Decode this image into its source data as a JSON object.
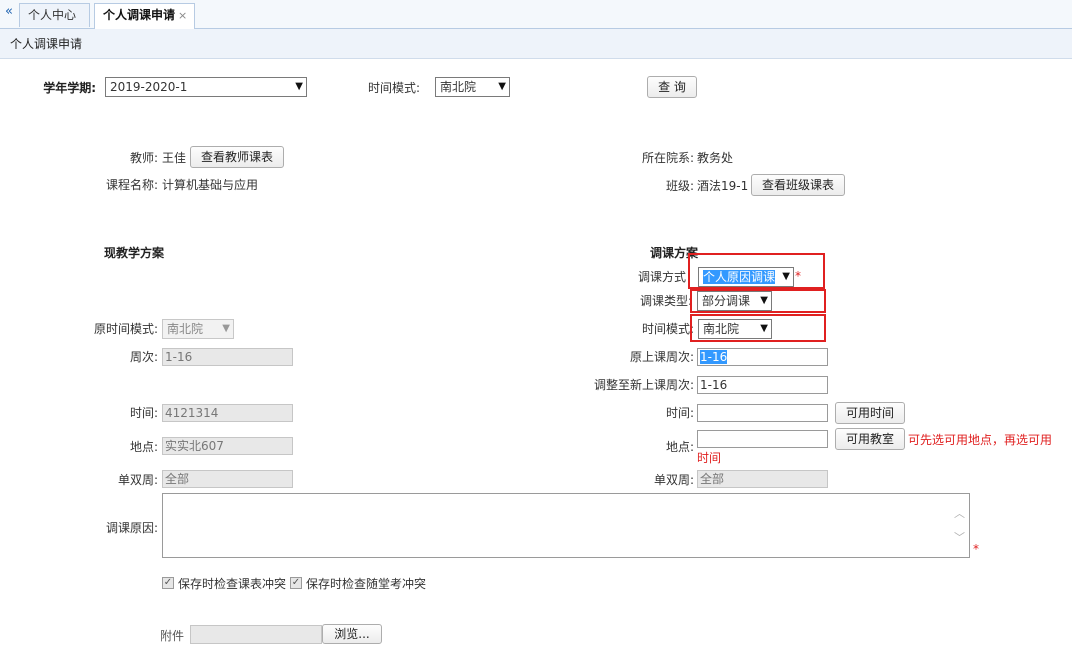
{
  "tabs": {
    "collapse_glyph": "«",
    "home": "个人中心",
    "active": "个人调课申请",
    "close_glyph": "×"
  },
  "page_title": "个人调课申请",
  "filter": {
    "term_label": "学年学期:",
    "term_value": "2019-2020-1",
    "time_mode_label": "时间模式:",
    "time_mode_value": "南北院",
    "query_button": "查 询"
  },
  "info": {
    "teacher_label": "教师:",
    "teacher_name": "王佳",
    "view_teacher_schedule": "查看教师课表",
    "course_label": "课程名称:",
    "course_name": "计算机基础与应用",
    "dept_label": "所在院系:",
    "dept_value": "教务处",
    "class_label": "班级:",
    "class_value": "酒法19-1",
    "view_class_schedule": "查看班级课表"
  },
  "current_plan": {
    "title": "现教学方案",
    "time_mode_label": "原时间模式:",
    "time_mode_value": "南北院",
    "weeks_label": "周次:",
    "weeks_value": "1-16",
    "time_label": "时间:",
    "time_value": "4121314",
    "place_label": "地点:",
    "place_value": "实实北607",
    "odd_even_label": "单双周:",
    "odd_even_value": "全部"
  },
  "adjust_plan": {
    "title": "调课方案",
    "method_label": "调课方式",
    "method_value": "个人原因调课",
    "required_mark": "*",
    "type_label": "调课类型:",
    "type_value": "部分调课",
    "time_mode_label": "时间模式:",
    "time_mode_value": "南北院",
    "orig_weeks_label": "原上课周次:",
    "orig_weeks_sel": "1",
    "orig_weeks_rest": "-16",
    "new_weeks_label": "调整至新上课周次:",
    "new_weeks_value": "1-16",
    "time_label": "时间:",
    "time_value": "",
    "avail_time_button": "可用时间",
    "place_label": "地点:",
    "place_value": "",
    "avail_room_button": "可用教室",
    "hint_line1": "可先选可用地点，再选可用",
    "hint_line2": "时间",
    "odd_even_label": "单双周:",
    "odd_even_value": "全部"
  },
  "reason": {
    "label": "调课原因:",
    "value": "",
    "required_mark": "*"
  },
  "checks": {
    "check1_label": "保存时检查课表冲突",
    "check2_label": "保存时检查随堂考冲突"
  },
  "attachment": {
    "label": "附件",
    "button": "浏览..."
  }
}
